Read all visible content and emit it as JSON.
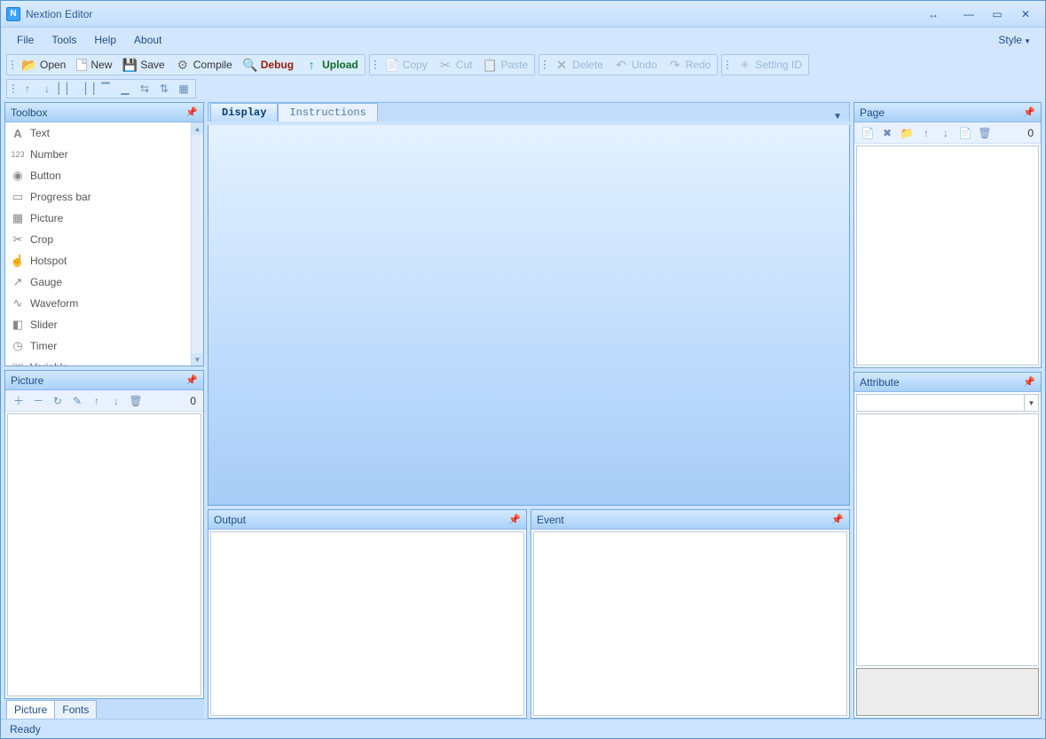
{
  "titlebar": {
    "title": "Nextion Editor"
  },
  "menubar": {
    "items": [
      "File",
      "Tools",
      "Help",
      "About"
    ],
    "style": "Style"
  },
  "toolbar": {
    "g1": [
      {
        "icon": "folder",
        "label": "Open",
        "disabled": false
      },
      {
        "icon": "file",
        "label": "New",
        "disabled": false
      },
      {
        "icon": "disk",
        "label": "Save",
        "disabled": false
      },
      {
        "icon": "gear",
        "label": "Compile",
        "disabled": false
      },
      {
        "icon": "bug",
        "label": "Debug",
        "disabled": false,
        "cls": "debug"
      },
      {
        "icon": "up",
        "label": "Upload",
        "disabled": false,
        "cls": "upload"
      }
    ],
    "g2": [
      {
        "icon": "copy",
        "label": "Copy",
        "disabled": true
      },
      {
        "icon": "scissor",
        "label": "Cut",
        "disabled": true
      },
      {
        "icon": "paste",
        "label": "Paste",
        "disabled": true
      }
    ],
    "g3": [
      {
        "icon": "x",
        "label": "Delete",
        "disabled": true
      },
      {
        "icon": "undo",
        "label": "Undo",
        "disabled": true
      },
      {
        "icon": "redo",
        "label": "Redo",
        "disabled": true
      }
    ],
    "g4": [
      {
        "icon": "settingid",
        "label": "Setting ID",
        "disabled": true
      }
    ]
  },
  "toolbox": {
    "title": "Toolbox",
    "items": [
      {
        "icon": "A",
        "label": "Text"
      },
      {
        "icon": "123",
        "label": "Number"
      },
      {
        "icon": "▶",
        "label": "Button"
      },
      {
        "icon": "▭",
        "label": "Progress bar"
      },
      {
        "icon": "▦",
        "label": "Picture"
      },
      {
        "icon": "✂",
        "label": "Crop"
      },
      {
        "icon": "☝",
        "label": "Hotspot"
      },
      {
        "icon": "⬈",
        "label": "Gauge"
      },
      {
        "icon": "∿",
        "label": "Waveform"
      },
      {
        "icon": "◧",
        "label": "Slider"
      },
      {
        "icon": "◷",
        "label": "Timer"
      },
      {
        "icon": "(X)",
        "label": "Variable"
      }
    ]
  },
  "picture": {
    "title": "Picture",
    "count": "0",
    "tabs": [
      "Picture",
      "Fonts"
    ]
  },
  "midtabs": {
    "display": "Display",
    "instructions": "Instructions"
  },
  "output": {
    "title": "Output"
  },
  "event": {
    "title": "Event"
  },
  "page": {
    "title": "Page",
    "count": "0"
  },
  "attribute": {
    "title": "Attribute"
  },
  "status": {
    "text": "Ready"
  }
}
